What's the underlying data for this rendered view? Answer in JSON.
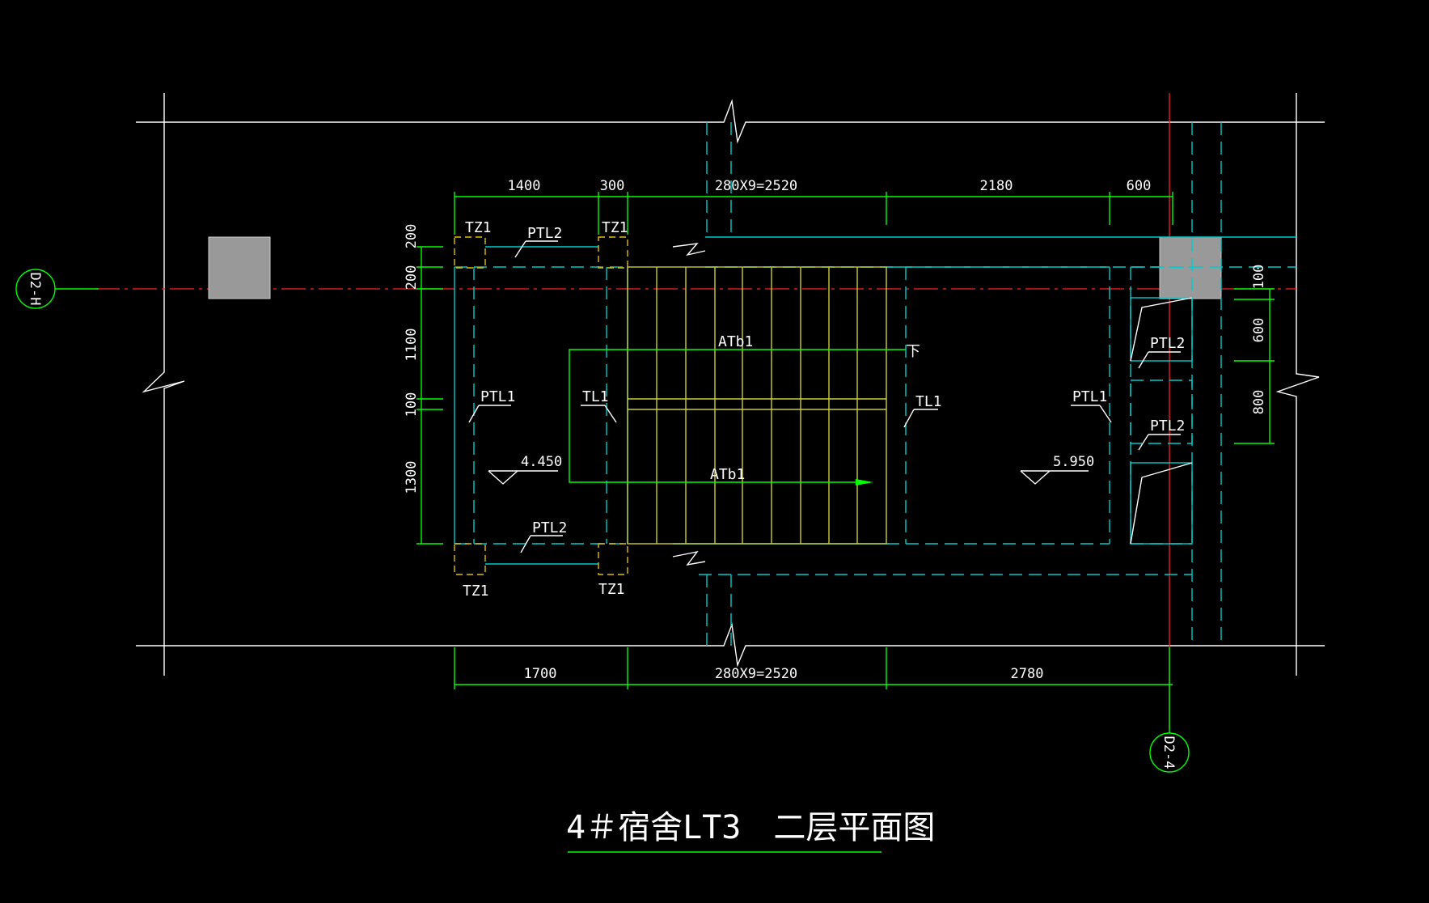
{
  "drawing": {
    "title": "4＃宿舍LT3　二层平面图",
    "axis_left": "D2-H",
    "axis_bottom": "D2-4",
    "top_dims": [
      "1400",
      "300",
      "280X9=2520",
      "2180",
      "600"
    ],
    "bottom_dims": [
      "1700",
      "280X9=2520",
      "2780"
    ],
    "left_dims": [
      "200",
      "200",
      "1100",
      "100",
      "1300"
    ],
    "right_dims": [
      "100",
      "600",
      "800"
    ],
    "labels": {
      "tz1": "TZ1",
      "ptl1": "PTL1",
      "ptl2": "PTL2",
      "tl1": "TL1",
      "atb1": "ATb1",
      "down": "下",
      "elev_left": "4.450",
      "elev_right": "5.950"
    }
  },
  "colors": {
    "background": "#000000",
    "dimension": "#00ff00",
    "wall": "#00cccc",
    "stair": "#cccc33",
    "axis": "#ff2020",
    "text": "#ffffff"
  }
}
